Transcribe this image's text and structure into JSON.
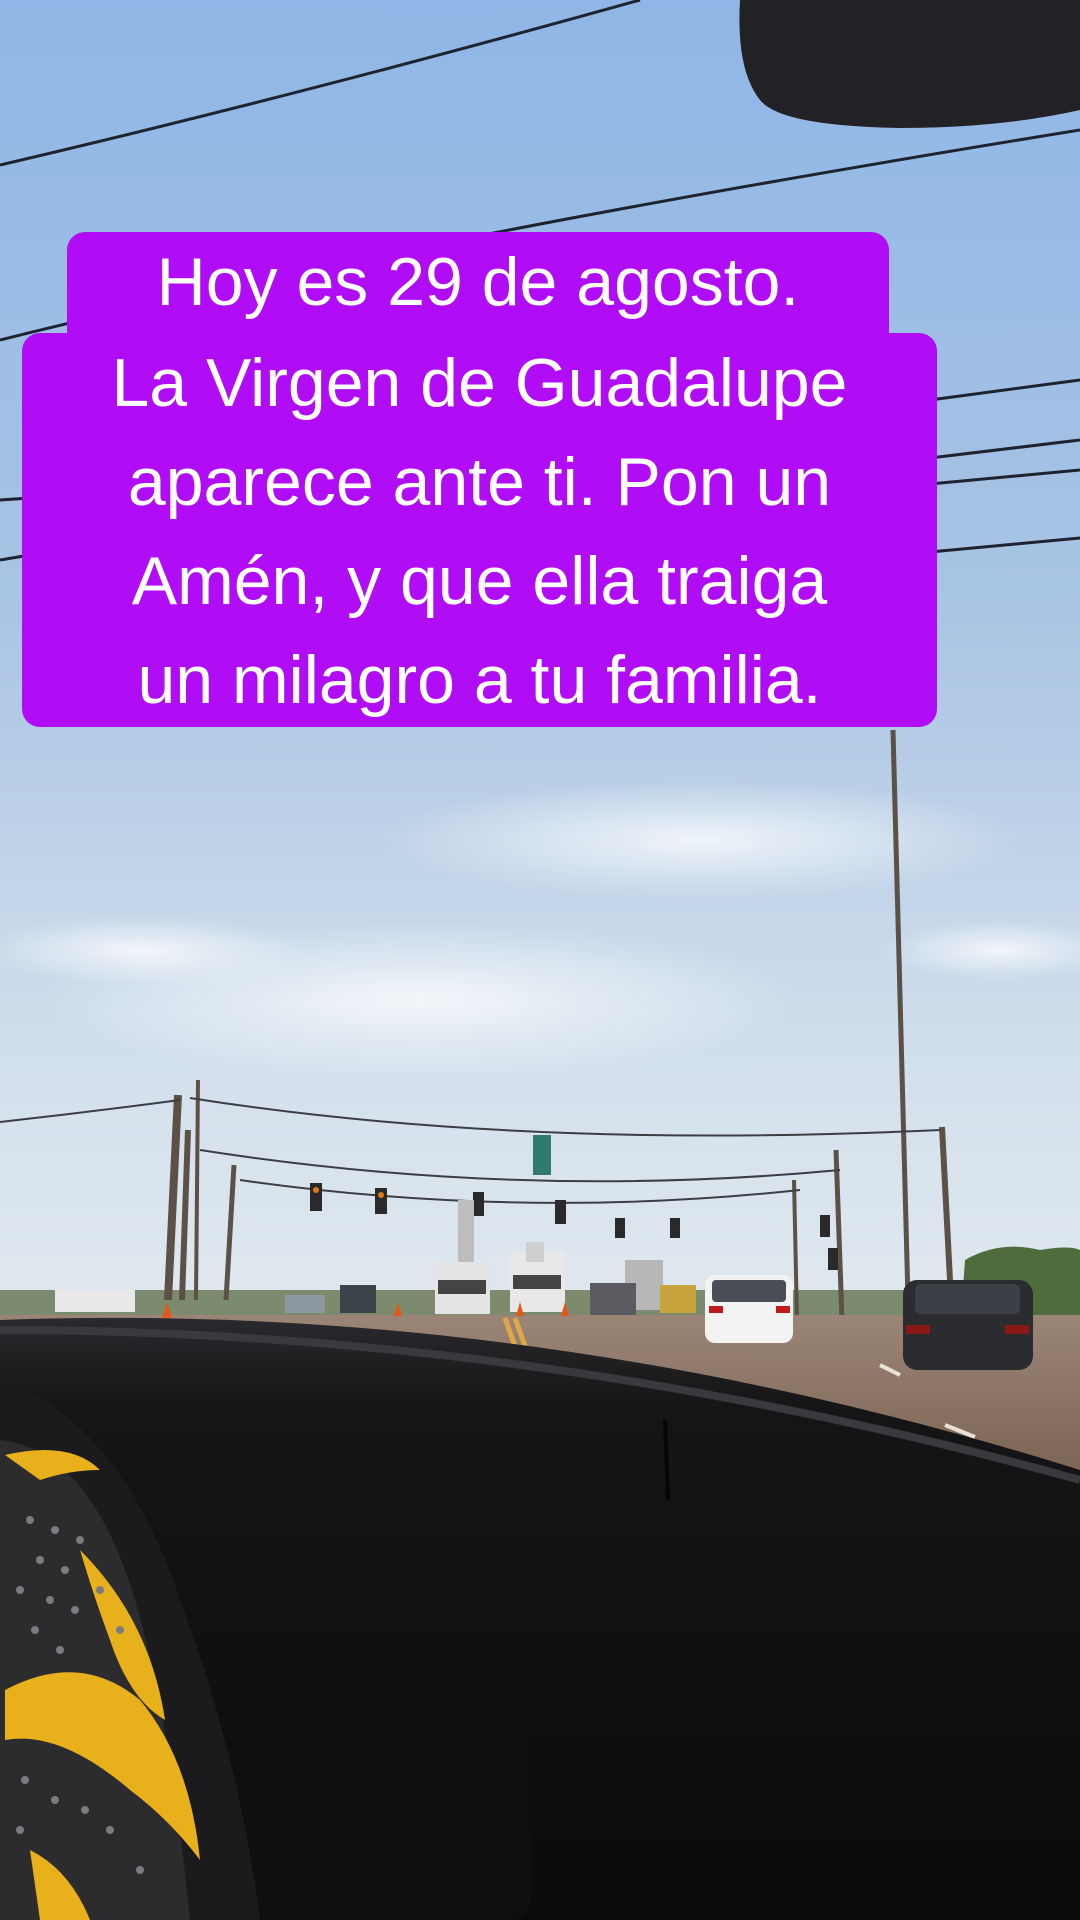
{
  "caption": {
    "lines": [
      "Hoy es 29 de agosto.",
      "La Virgen de Guadalupe",
      "aparece ante ti. Pon un",
      "Amén, y que ella traiga",
      "un milagro a tu familia."
    ]
  },
  "colors": {
    "caption_background": "#b10cf6",
    "caption_text": "#ffffff",
    "sky_top": "#9dbfe6",
    "sky_horizon": "#d6e3ef",
    "road": "#8a7060",
    "dashboard": "#121214",
    "steering_accent": "#e8b11c"
  }
}
